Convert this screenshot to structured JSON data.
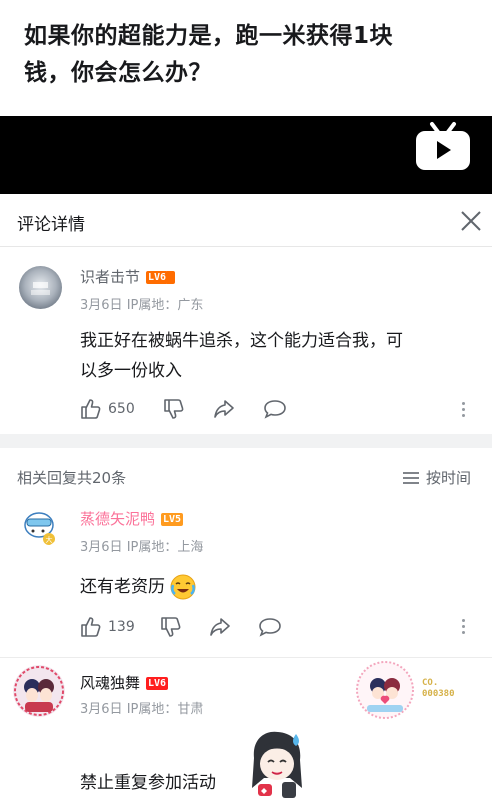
{
  "video": {
    "title_line1": "如果你的超能力是，跑一米获得1块",
    "title_line2": "钱，你会怎么办？"
  },
  "panel": {
    "title": "评论详情"
  },
  "main_comment": {
    "username": "识者击节",
    "level": "LV6",
    "date": "3月6日",
    "ip": "IP属地：广东",
    "text_line1": "我正好在被蜗牛追杀，这个能力适合我，可",
    "text_line2": "以多一份收入",
    "likes": "650"
  },
  "replies_header": {
    "count_text": "相关回复共20条",
    "sort_label": "按时间"
  },
  "replies": [
    {
      "username": "蒸德矢泥鸭",
      "level": "LV5",
      "date": "3月6日",
      "ip": "IP属地：上海",
      "text": "还有老资历",
      "likes": "139",
      "name_color": "#fb7299"
    },
    {
      "username": "风魂独舞",
      "level": "LV6",
      "date": "3月6日",
      "ip": "IP属地：甘肃",
      "text": "禁止重复参加活动",
      "badge_line1": "CO.",
      "badge_line2": "000380"
    }
  ],
  "colors": {
    "lv6": "#ff6c00",
    "lv5": "#ff9b1f",
    "lv6b": "#ff1e1e",
    "pink": "#fb7299",
    "gray": "#9499a0"
  }
}
